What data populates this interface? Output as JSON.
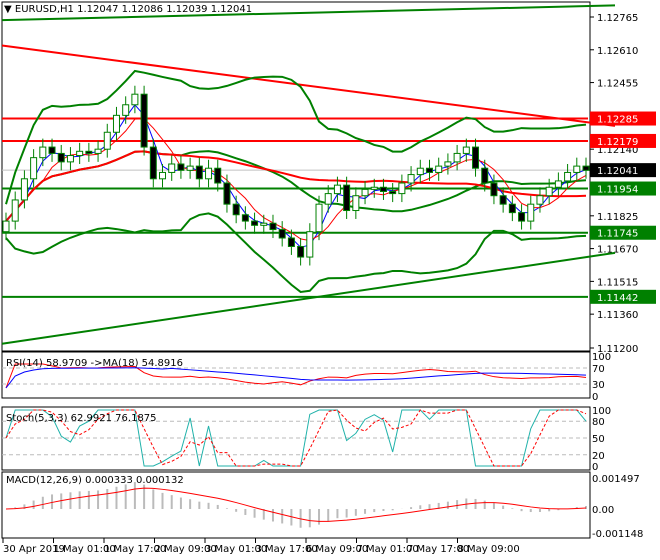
{
  "header": {
    "symbol": "EURUSD,H1",
    "open": "1.12047",
    "high": "1.12086",
    "low": "1.12039",
    "close": "1.12041"
  },
  "colors": {
    "up": "#008000",
    "down": "#008000",
    "red": "#ff0000",
    "green": "#008000",
    "blue": "#0000ff",
    "teal": "#20b2aa",
    "bid": "#000000"
  },
  "price_axis": {
    "ticks": [
      "1.12765",
      "1.12610",
      "1.12455",
      "1.12140",
      "1.11825",
      "1.11670",
      "1.11515",
      "1.11360",
      "1.11200"
    ],
    "range": [
      1.112,
      1.12765
    ]
  },
  "levels": [
    {
      "price": "1.12285",
      "color": "#ff0000"
    },
    {
      "price": "1.12179",
      "color": "#ff0000"
    },
    {
      "price": "1.11954",
      "color": "#008000"
    },
    {
      "price": "1.11745",
      "color": "#008000"
    },
    {
      "price": "1.11442",
      "color": "#008000"
    }
  ],
  "bid": {
    "price": "1.12041"
  },
  "indicators": {
    "rsi": {
      "label": "RSI(14) 58.9709  ->MA(18) 54.8916",
      "ticks": [
        "100",
        "70",
        "30",
        "0"
      ]
    },
    "stoch": {
      "label": "Stoch(5,3,3) 62.9921 76.1875",
      "ticks": [
        "100",
        "80",
        "50",
        "20",
        "0"
      ]
    },
    "macd": {
      "label": "MACD(12,26,9) 0.000333 0.000132",
      "ticks": [
        "0.001497",
        "0.00",
        "-0.001148"
      ]
    }
  },
  "time_axis": [
    "30 Apr 2019",
    "1 May 01:00",
    "1 May 17:00",
    "2 May 09:00",
    "3 May 01:00",
    "3 May 17:00",
    "6 May 09:00",
    "7 May 01:00",
    "7 May 17:00",
    "8 May 09:00"
  ],
  "chart_data": {
    "type": "line",
    "title": "EURUSD,H1",
    "ylim": [
      1.112,
      1.12765
    ],
    "closes": [
      1.118,
      1.119,
      1.12,
      1.121,
      1.1215,
      1.1212,
      1.1208,
      1.1211,
      1.1213,
      1.1212,
      1.1214,
      1.1222,
      1.123,
      1.1235,
      1.124,
      1.1215,
      1.12,
      1.1203,
      1.1207,
      1.1204,
      1.1206,
      1.12,
      1.1205,
      1.1198,
      1.1188,
      1.1183,
      1.118,
      1.1178,
      1.1179,
      1.1176,
      1.1172,
      1.1168,
      1.1163,
      1.1175,
      1.1188,
      1.1193,
      1.1197,
      1.1185,
      1.1192,
      1.1195,
      1.1196,
      1.1194,
      1.1193,
      1.1198,
      1.1202,
      1.1205,
      1.1203,
      1.1206,
      1.1208,
      1.1212,
      1.1215,
      1.1205,
      1.1198,
      1.1192,
      1.1188,
      1.1184,
      1.118,
      1.1188,
      1.1192,
      1.1196,
      1.1199,
      1.1203,
      1.1206,
      1.1204
    ],
    "trendlines": [
      {
        "color": "#ff0000",
        "from": 1.1263,
        "to": 1.1225
      },
      {
        "color": "#008000",
        "from": 1.1275,
        "to": 1.1282
      },
      {
        "color": "#008000",
        "from": 1.1122,
        "to": 1.1165
      }
    ]
  }
}
